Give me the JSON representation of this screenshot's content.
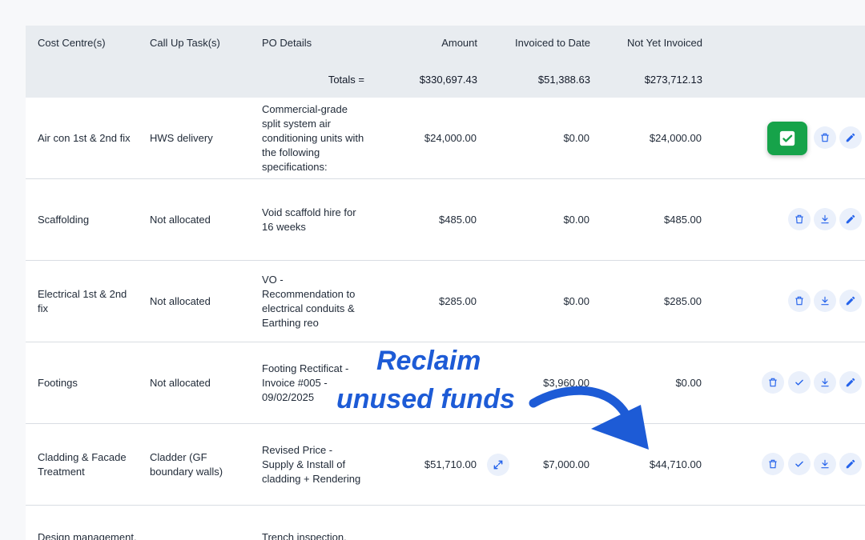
{
  "header": {
    "cost_centre": "Cost Centre(s)",
    "call_up_task": "Call Up Task(s)",
    "po_details": "PO Details",
    "amount": "Amount",
    "invoiced_to_date": "Invoiced to Date",
    "not_yet_invoiced": "Not Yet Invoiced"
  },
  "totals": {
    "label": "Totals =",
    "amount": "$330,697.43",
    "invoiced": "$51,388.63",
    "not_invoiced": "$273,712.13"
  },
  "rows": [
    {
      "cost": "Air con 1st & 2nd fix",
      "task": "HWS delivery",
      "po": "Commercial-grade split system air conditioning units with the following specifications:",
      "amount": "$24,000.00",
      "invoiced": "$0.00",
      "not_invoiced": "$24,000.00"
    },
    {
      "cost": "Scaffolding",
      "task": "Not allocated",
      "po": "Void scaffold hire for 16 weeks",
      "amount": "$485.00",
      "invoiced": "$0.00",
      "not_invoiced": "$485.00"
    },
    {
      "cost": "Electrical 1st & 2nd fix",
      "task": "Not allocated",
      "po": "VO - Recommendation to electrical conduits & Earthing reo",
      "amount": "$285.00",
      "invoiced": "$0.00",
      "not_invoiced": "$285.00"
    },
    {
      "cost": "Footings",
      "task": "Not allocated",
      "po": "Footing Rectificat - Invoice #005 - 09/02/2025",
      "amount": "",
      "invoiced": "$3,960.00",
      "not_invoiced": "$0.00"
    },
    {
      "cost": "Cladding & Facade Treatment",
      "task": "Cladder (GF boundary walls)",
      "po": "Revised Price - Supply & Install of cladding + Rendering",
      "amount": "$51,710.00",
      "invoiced": "$7,000.00",
      "not_invoiced": "$44,710.00"
    },
    {
      "cost": "Design management,",
      "task": "",
      "po": "Trench inspection,",
      "amount": "",
      "invoiced": "",
      "not_invoiced": ""
    }
  ],
  "overlay": {
    "line1": "Reclaim",
    "line2": "unused funds"
  },
  "colors": {
    "accent": "#2563eb",
    "success": "#16a34a",
    "header_bg": "#e8ecf0",
    "callout": "#1d5bd6"
  }
}
